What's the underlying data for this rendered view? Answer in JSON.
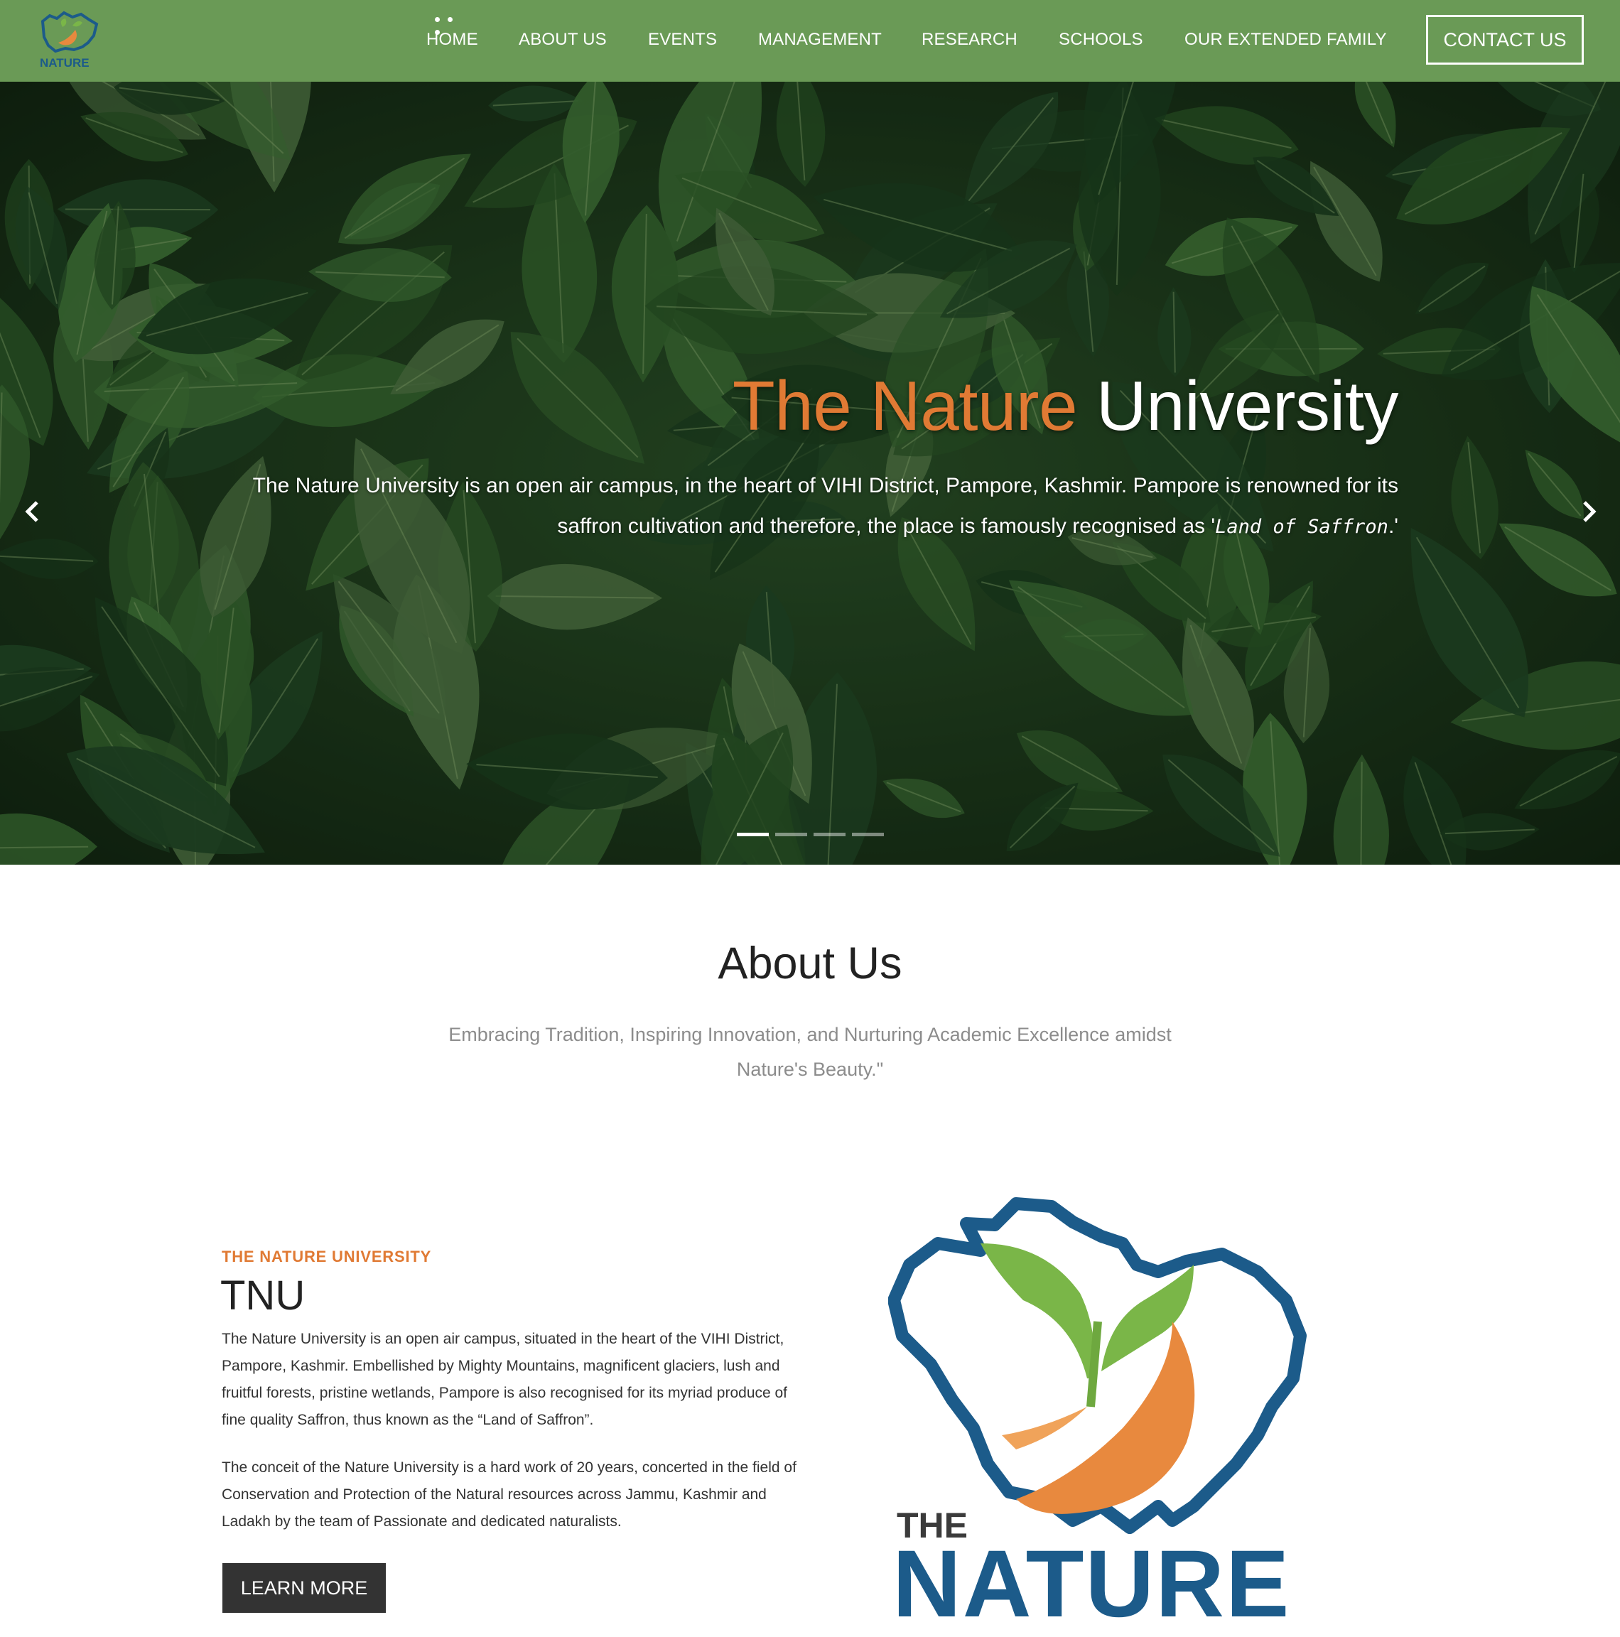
{
  "nav": {
    "logo_text": "NATURE",
    "items": [
      {
        "label": "HOME"
      },
      {
        "label": "ABOUT US"
      },
      {
        "label": "EVENTS"
      },
      {
        "label": "MANAGEMENT"
      },
      {
        "label": "RESEARCH"
      },
      {
        "label": "SCHOOLS"
      },
      {
        "label": "OUR EXTENDED FAMILY"
      }
    ],
    "contact_label": "CONTACT US",
    "menu_icon": "more-dots-icon"
  },
  "hero": {
    "title_accent": "The Nature",
    "title_plain": "University",
    "text_main": "The Nature University is an open air campus, in the heart of VIHI District, Pampore, Kashmir. Pampore is renowned for its saffron cultivation and therefore, the place is famously recognised as '",
    "text_em": "Land of Saffron",
    "text_end": ".'",
    "prev_icon": "chevron-left-icon",
    "next_icon": "chevron-right-icon",
    "slide_count": 4,
    "active_slide": 1
  },
  "about": {
    "heading": "About Us",
    "subtitle": "Embracing Tradition, Inspiring Innovation, and Nurturing Academic Excellence amidst Nature's Beauty.\"",
    "kicker": "THE NATURE UNIVERSITY",
    "title": "TNU",
    "paragraph1": "The Nature University is an open air campus, situated in the heart of the VIHI District, Pampore, Kashmir. Embellished by Mighty Mountains, magnificent glaciers, lush and fruitful forests, pristine wetlands, Pampore is also recognised for its myriad produce of fine quality Saffron, thus known as the “Land of Saffron”.",
    "paragraph2": "The conceit of the Nature University is a hard work of 20 years, concerted in the field of Conservation and Protection of the Natural resources across Jammu, Kashmir and Ladakh by the team of Passionate and dedicated naturalists.",
    "learn_more": "LEARN MORE",
    "logo_line1": "THE",
    "logo_line2": "NATURE"
  },
  "colors": {
    "nav_bg": "#6a9a56",
    "accent_orange": "#e07a34",
    "logo_blue": "#1c5b8a",
    "button_dark": "#333333"
  }
}
